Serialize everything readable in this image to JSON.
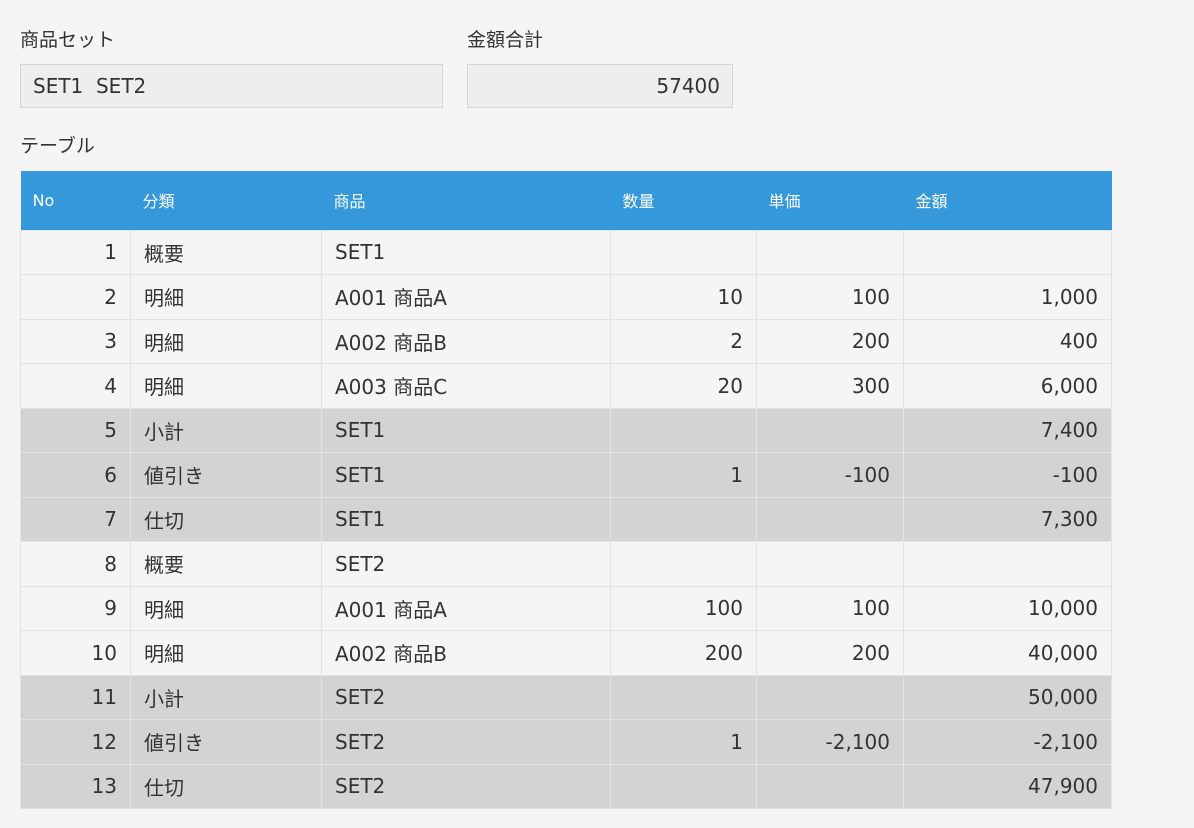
{
  "set_field": {
    "label": "商品セット",
    "value": "SET1  SET2"
  },
  "total_field": {
    "label": "金額合計",
    "value": "57400"
  },
  "table": {
    "label": "テーブル",
    "headers": [
      "No",
      "分類",
      "商品",
      "数量",
      "単価",
      "金額"
    ],
    "rows": [
      {
        "no": "1",
        "category": "概要",
        "product": "SET1",
        "qty": "",
        "price": "",
        "amount": "",
        "style": "normal"
      },
      {
        "no": "2",
        "category": "明細",
        "product": "A001 商品A",
        "qty": "10",
        "price": "100",
        "amount": "1,000",
        "style": "normal"
      },
      {
        "no": "3",
        "category": "明細",
        "product": "A002 商品B",
        "qty": "2",
        "price": "200",
        "amount": "400",
        "style": "normal"
      },
      {
        "no": "4",
        "category": "明細",
        "product": "A003 商品C",
        "qty": "20",
        "price": "300",
        "amount": "6,000",
        "style": "normal"
      },
      {
        "no": "5",
        "category": "小計",
        "product": "SET1",
        "qty": "",
        "price": "",
        "amount": "7,400",
        "style": "gray"
      },
      {
        "no": "6",
        "category": "値引き",
        "product": "SET1",
        "qty": "1",
        "price": "-100",
        "amount": "-100",
        "style": "gray"
      },
      {
        "no": "7",
        "category": "仕切",
        "product": "SET1",
        "qty": "",
        "price": "",
        "amount": "7,300",
        "style": "gray"
      },
      {
        "no": "8",
        "category": "概要",
        "product": "SET2",
        "qty": "",
        "price": "",
        "amount": "",
        "style": "normal"
      },
      {
        "no": "9",
        "category": "明細",
        "product": "A001 商品A",
        "qty": "100",
        "price": "100",
        "amount": "10,000",
        "style": "normal"
      },
      {
        "no": "10",
        "category": "明細",
        "product": "A002 商品B",
        "qty": "200",
        "price": "200",
        "amount": "40,000",
        "style": "normal"
      },
      {
        "no": "11",
        "category": "小計",
        "product": "SET2",
        "qty": "",
        "price": "",
        "amount": "50,000",
        "style": "gray"
      },
      {
        "no": "12",
        "category": "値引き",
        "product": "SET2",
        "qty": "1",
        "price": "-2,100",
        "amount": "-2,100",
        "style": "gray"
      },
      {
        "no": "13",
        "category": "仕切",
        "product": "SET2",
        "qty": "",
        "price": "",
        "amount": "47,900",
        "style": "gray"
      }
    ]
  },
  "colors": {
    "header_bg": "#3498db",
    "subtotal_row_bg": "#d3d3d3",
    "page_bg": "#f5f5f5"
  }
}
